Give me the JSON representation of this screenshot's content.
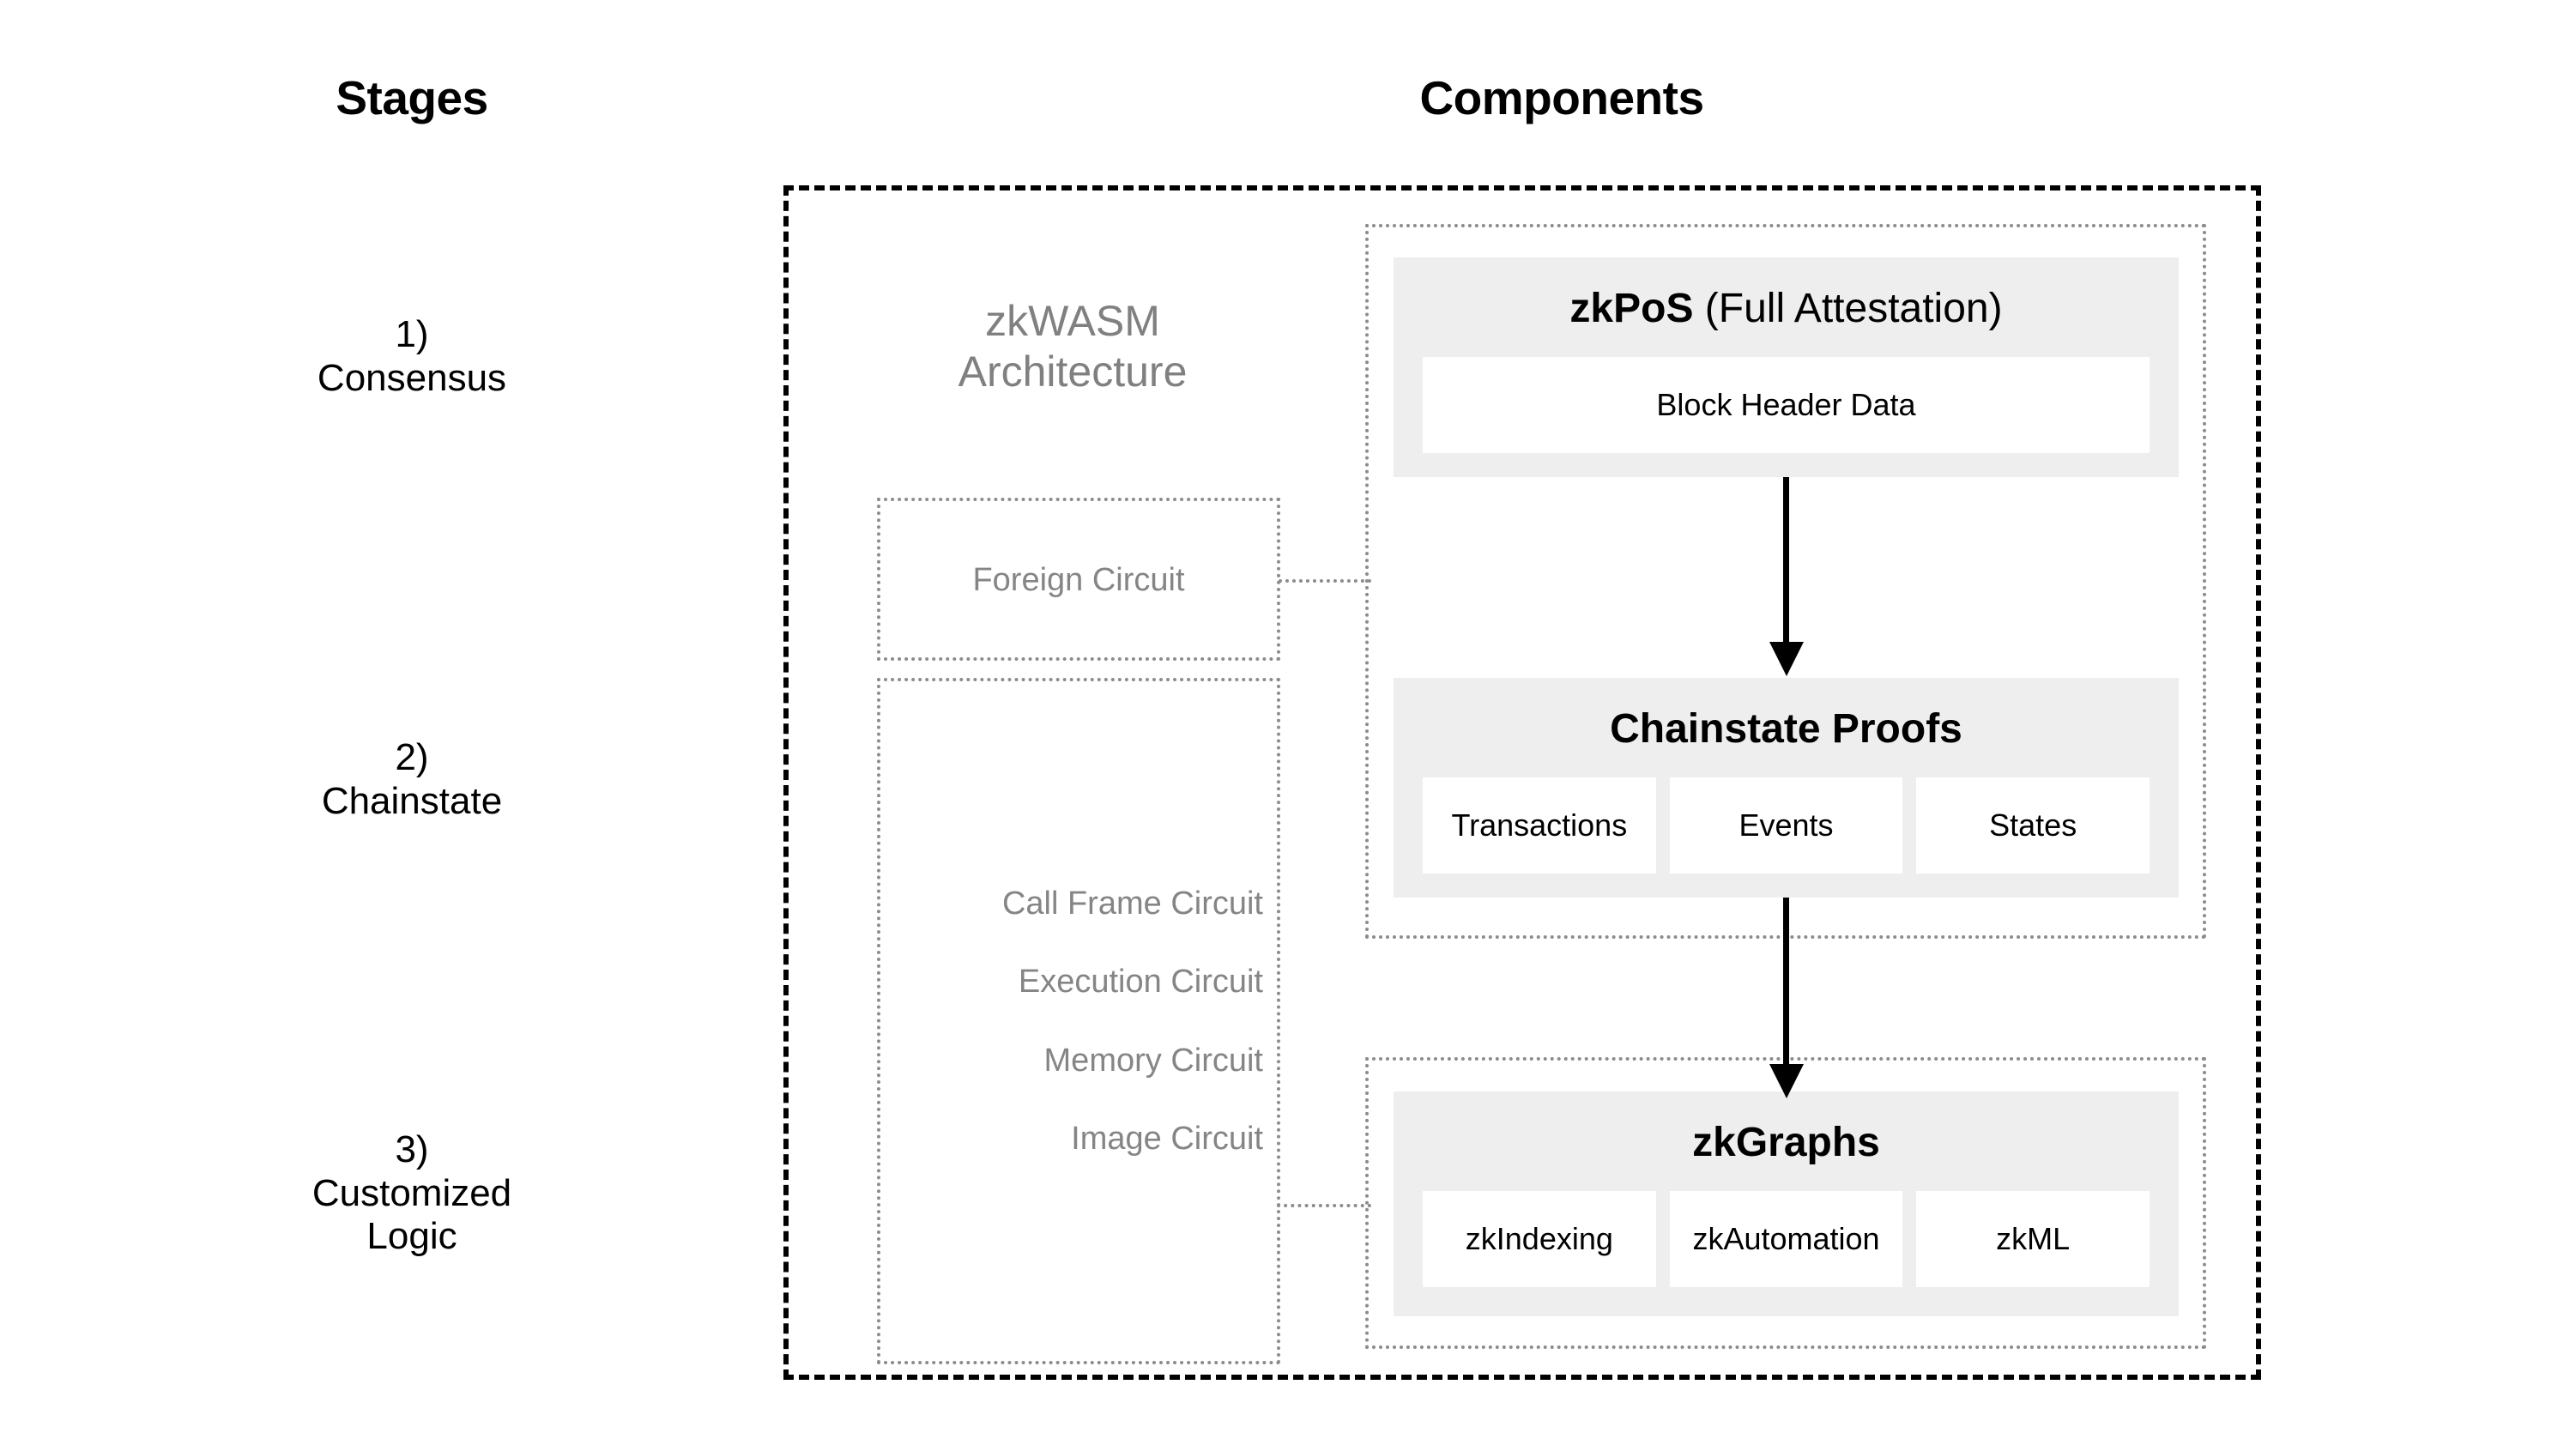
{
  "headings": {
    "stages": "Stages",
    "components": "Components"
  },
  "stages": [
    {
      "id": "1",
      "label": "1)\nConsensus"
    },
    {
      "id": "2",
      "label": "2)\nChainstate"
    },
    {
      "id": "3",
      "label": "3)\nCustomized\nLogic"
    }
  ],
  "architecture": {
    "title": "zkWASM\nArchitecture",
    "foreign_circuit": {
      "label": "Foreign Circuit"
    },
    "wasm_circuits": [
      {
        "label": "Call Frame Circuit"
      },
      {
        "label": "Execution Circuit"
      },
      {
        "label": "Memory Circuit"
      },
      {
        "label": "Image Circuit"
      }
    ]
  },
  "components": [
    {
      "id": "zkpos",
      "title_bold": "zkPoS",
      "title_regular": " (Full Attestation)",
      "items": [
        "Block Header Data"
      ]
    },
    {
      "id": "chainstate",
      "title_bold": "Chainstate Proofs",
      "title_regular": "",
      "items": [
        "Transactions",
        "Events",
        "States"
      ]
    },
    {
      "id": "zkgraphs",
      "title_bold": "zkGraphs",
      "title_regular": "",
      "items": [
        "zkIndexing",
        "zkAutomation",
        "zkML"
      ]
    }
  ],
  "colors": {
    "panel_background": "#eeeeee",
    "sub_box_background": "#ffffff",
    "muted_text": "#808080",
    "dotted_border": "#8c8c8c",
    "frame_border": "#000000",
    "text": "#000000"
  }
}
